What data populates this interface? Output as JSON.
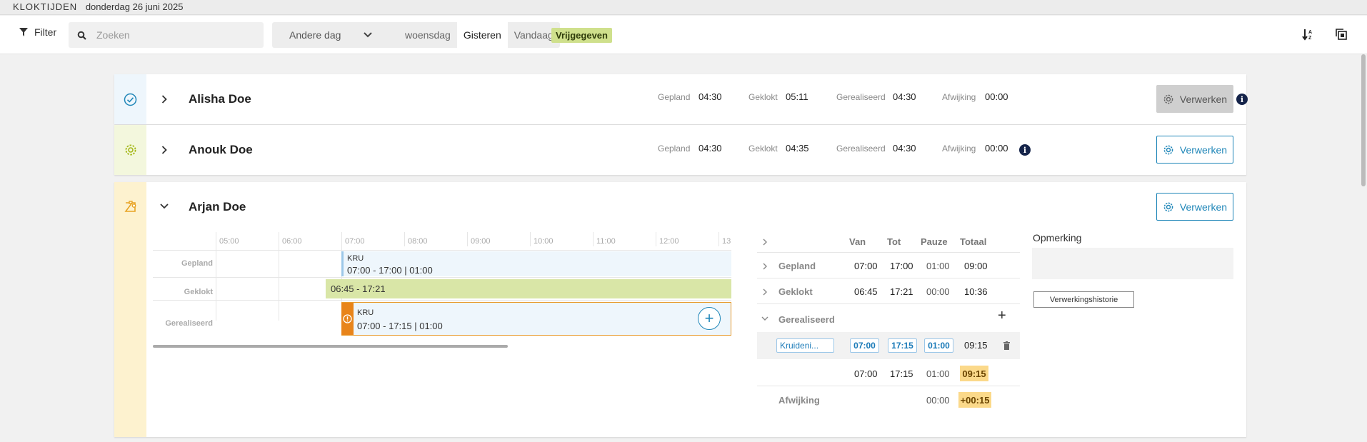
{
  "topbar": {
    "app": "KLOKTIJDEN",
    "date": "donderdag 26 juni 2025"
  },
  "toolbar": {
    "filter_label": "Filter",
    "search_placeholder": "Zoeken",
    "other_day_label": "Andere dag",
    "days": [
      "woensdag",
      "Gisteren",
      "Vandaag"
    ],
    "active_day": "Gisteren",
    "status_badge": "Vrijgegeven",
    "icons": [
      "filter-icon",
      "search-icon",
      "chevron-down-icon",
      "sort-icon",
      "copy-icon"
    ]
  },
  "colors": {
    "accent": "#1f86b8",
    "badge": "#cfe08c",
    "highlight": "#fbd98a",
    "warning": "#e8841a"
  },
  "employees": [
    {
      "name": "Alisha Doe",
      "status_icon": "check-circle-icon",
      "stats": {
        "gepland_label": "Gepland",
        "gepland": "04:30",
        "geklokt_label": "Geklokt",
        "geklokt": "05:11",
        "gerealiseerd_label": "Gerealiseerd",
        "gerealiseerd": "04:30",
        "afwijking_label": "Afwijking",
        "afwijking": "00:00"
      },
      "action": "Verwerken",
      "action_state": "disabled"
    },
    {
      "name": "Anouk Doe",
      "status_icon": "gear-icon",
      "stats": {
        "gepland_label": "Gepland",
        "gepland": "04:30",
        "geklokt_label": "Geklokt",
        "geklokt": "04:35",
        "gerealiseerd_label": "Gerealiseerd",
        "gerealiseerd": "04:30",
        "afwijking_label": "Afwijking",
        "afwijking": "00:00"
      },
      "action": "Verwerken",
      "action_state": "enabled"
    },
    {
      "name": "Arjan Doe",
      "status_icon": "clipboard-icon",
      "action": "Verwerken",
      "timeline": {
        "hours": [
          "05:00",
          "06:00",
          "07:00",
          "08:00",
          "09:00",
          "10:00",
          "11:00",
          "12:00",
          "13"
        ],
        "rows": [
          "Gepland",
          "Geklokt",
          "Gerealiseerd"
        ],
        "gepland_code": "KRU",
        "gepland_time": "07:00 - 17:00 | 01:00",
        "geklokt_time": "06:45 - 17:21",
        "gerealiseerd_code": "KRU",
        "gerealiseerd_time": "07:00 - 17:15 | 01:00"
      },
      "detail": {
        "headers": [
          "Van",
          "Tot",
          "Pauze",
          "Totaal"
        ],
        "gepland": {
          "label": "Gepland",
          "van": "07:00",
          "tot": "17:00",
          "pauze": "01:00",
          "totaal": "09:00"
        },
        "geklokt": {
          "label": "Geklokt",
          "van": "06:45",
          "tot": "17:21",
          "pauze": "00:00",
          "totaal": "10:36"
        },
        "gerealiseerd_label": "Gerealiseerd",
        "entry": {
          "department": "Kruideni...",
          "van": "07:00",
          "tot": "17:15",
          "pauze": "01:00",
          "totaal": "09:15"
        },
        "sum": {
          "van": "07:00",
          "tot": "17:15",
          "pauze": "01:00",
          "totaal": "09:15"
        },
        "afwijking": {
          "label": "Afwijking",
          "pauze": "00:00",
          "totaal": "+00:15"
        }
      },
      "opmerking_label": "Opmerking",
      "history_button": "Verwerkingshistorie"
    }
  ]
}
